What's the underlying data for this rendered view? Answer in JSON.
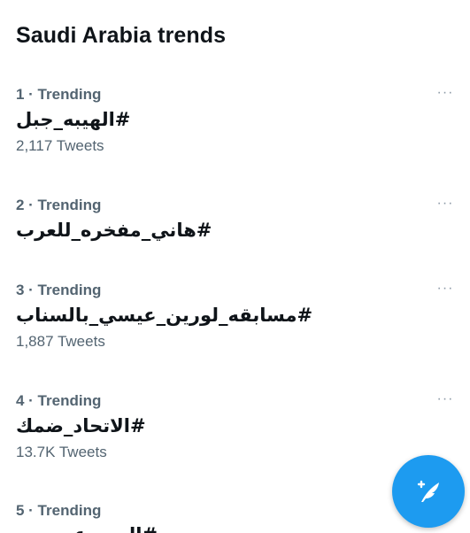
{
  "section": {
    "title": "Saudi Arabia trends"
  },
  "more_label": "···",
  "trends": [
    {
      "meta": "1 · Trending",
      "hashtag": "#الهيبه_جبل",
      "tweets": "2,117 Tweets"
    },
    {
      "meta": "2 · Trending",
      "hashtag": "#هاني_مفخره_للعرب",
      "tweets": ""
    },
    {
      "meta": "3 · Trending",
      "hashtag": "#مسابقه_لورين_عيسي_بالسناب",
      "tweets": "1,887 Tweets"
    },
    {
      "meta": "4 · Trending",
      "hashtag": "#الاتحاد_ضمك",
      "tweets": "13.7K Tweets"
    },
    {
      "meta": "5 · Trending",
      "hashtag": "#اليوم_عيد",
      "tweets": ""
    }
  ],
  "fab": {
    "icon": "compose-tweet-icon",
    "color": "#1d9bf0"
  },
  "colors": {
    "text_primary": "#0f1419",
    "text_secondary": "#536471",
    "accent": "#1d9bf0"
  }
}
